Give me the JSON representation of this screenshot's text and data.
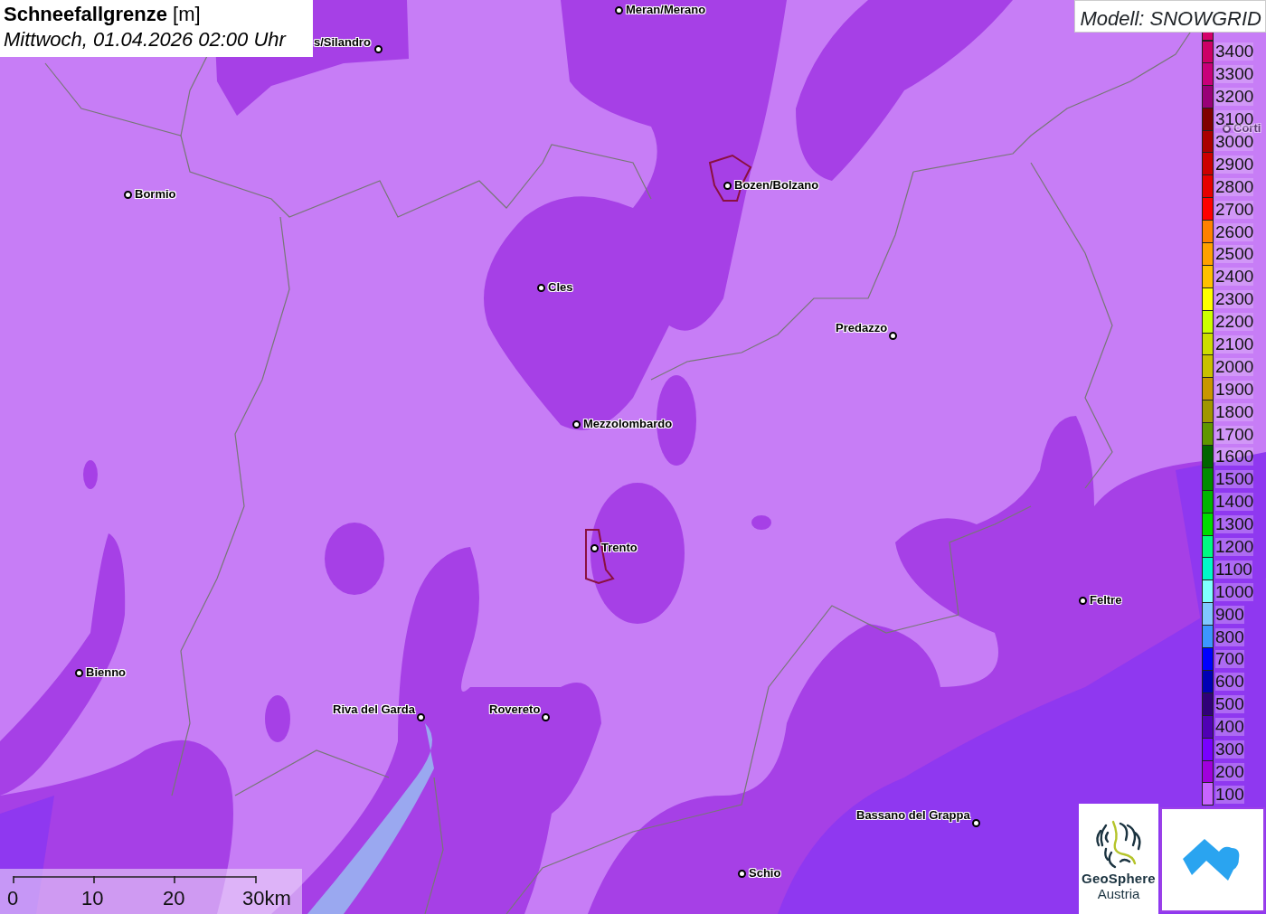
{
  "title": {
    "heading": "**Schneefallgrenze** [m]",
    "datetime": "Mittwoch, 01.04.2026 02:00 Uhr"
  },
  "model_label": "Modell: SNOWGRID",
  "legend": [
    {
      "label": "3400",
      "color": "#cc0066"
    },
    {
      "label": "3300",
      "color": "#c8007a"
    },
    {
      "label": "3200",
      "color": "#990077"
    },
    {
      "label": "3100",
      "color": "#800000"
    },
    {
      "label": "3000",
      "color": "#aa0000"
    },
    {
      "label": "2900",
      "color": "#cc0000"
    },
    {
      "label": "2800",
      "color": "#e60000"
    },
    {
      "label": "2700",
      "color": "#ff0000"
    },
    {
      "label": "2600",
      "color": "#ff8000"
    },
    {
      "label": "2500",
      "color": "#ffa000"
    },
    {
      "label": "2400",
      "color": "#ffc000"
    },
    {
      "label": "2300",
      "color": "#ffff00"
    },
    {
      "label": "2200",
      "color": "#ccff00"
    },
    {
      "label": "2100",
      "color": "#ccdd00"
    },
    {
      "label": "2000",
      "color": "#c8c000"
    },
    {
      "label": "1900",
      "color": "#c89600"
    },
    {
      "label": "1800",
      "color": "#a09600"
    },
    {
      "label": "1700",
      "color": "#609600"
    },
    {
      "label": "1600",
      "color": "#006400"
    },
    {
      "label": "1500",
      "color": "#008c00"
    },
    {
      "label": "1400",
      "color": "#00b400"
    },
    {
      "label": "1300",
      "color": "#00dc00"
    },
    {
      "label": "1200",
      "color": "#00fa82"
    },
    {
      "label": "1100",
      "color": "#00fac8"
    },
    {
      "label": "1000",
      "color": "#80ffff"
    },
    {
      "label": "900",
      "color": "#80c8ff"
    },
    {
      "label": "800",
      "color": "#3c96ff"
    },
    {
      "label": "700",
      "color": "#0000ff"
    },
    {
      "label": "600",
      "color": "#0000b4"
    },
    {
      "label": "500",
      "color": "#300078"
    },
    {
      "label": "400",
      "color": "#5000b4"
    },
    {
      "label": "300",
      "color": "#7800ff"
    },
    {
      "label": "200",
      "color": "#a000dc"
    },
    {
      "label": "100",
      "color": "#c864ff"
    }
  ],
  "cities": [
    {
      "name": "Meran/Merano"
    },
    {
      "name": "s/Silandro"
    },
    {
      "name": "Bormio"
    },
    {
      "name": "Bozen/Bolzano"
    },
    {
      "name": "Cles"
    },
    {
      "name": "Predazzo"
    },
    {
      "name": "Mezzolombardo"
    },
    {
      "name": "Trento"
    },
    {
      "name": "Feltre"
    },
    {
      "name": "Bienno"
    },
    {
      "name": "Riva del Garda"
    },
    {
      "name": "Rovereto"
    },
    {
      "name": "Bassano del Grappa"
    },
    {
      "name": "Schio"
    },
    {
      "name": "Corti"
    }
  ],
  "scale_bar": {
    "ticks": [
      "0",
      "10",
      "20",
      "30km"
    ]
  },
  "logo": {
    "line_1": "GeoSphere",
    "line_2": "Austria"
  }
}
